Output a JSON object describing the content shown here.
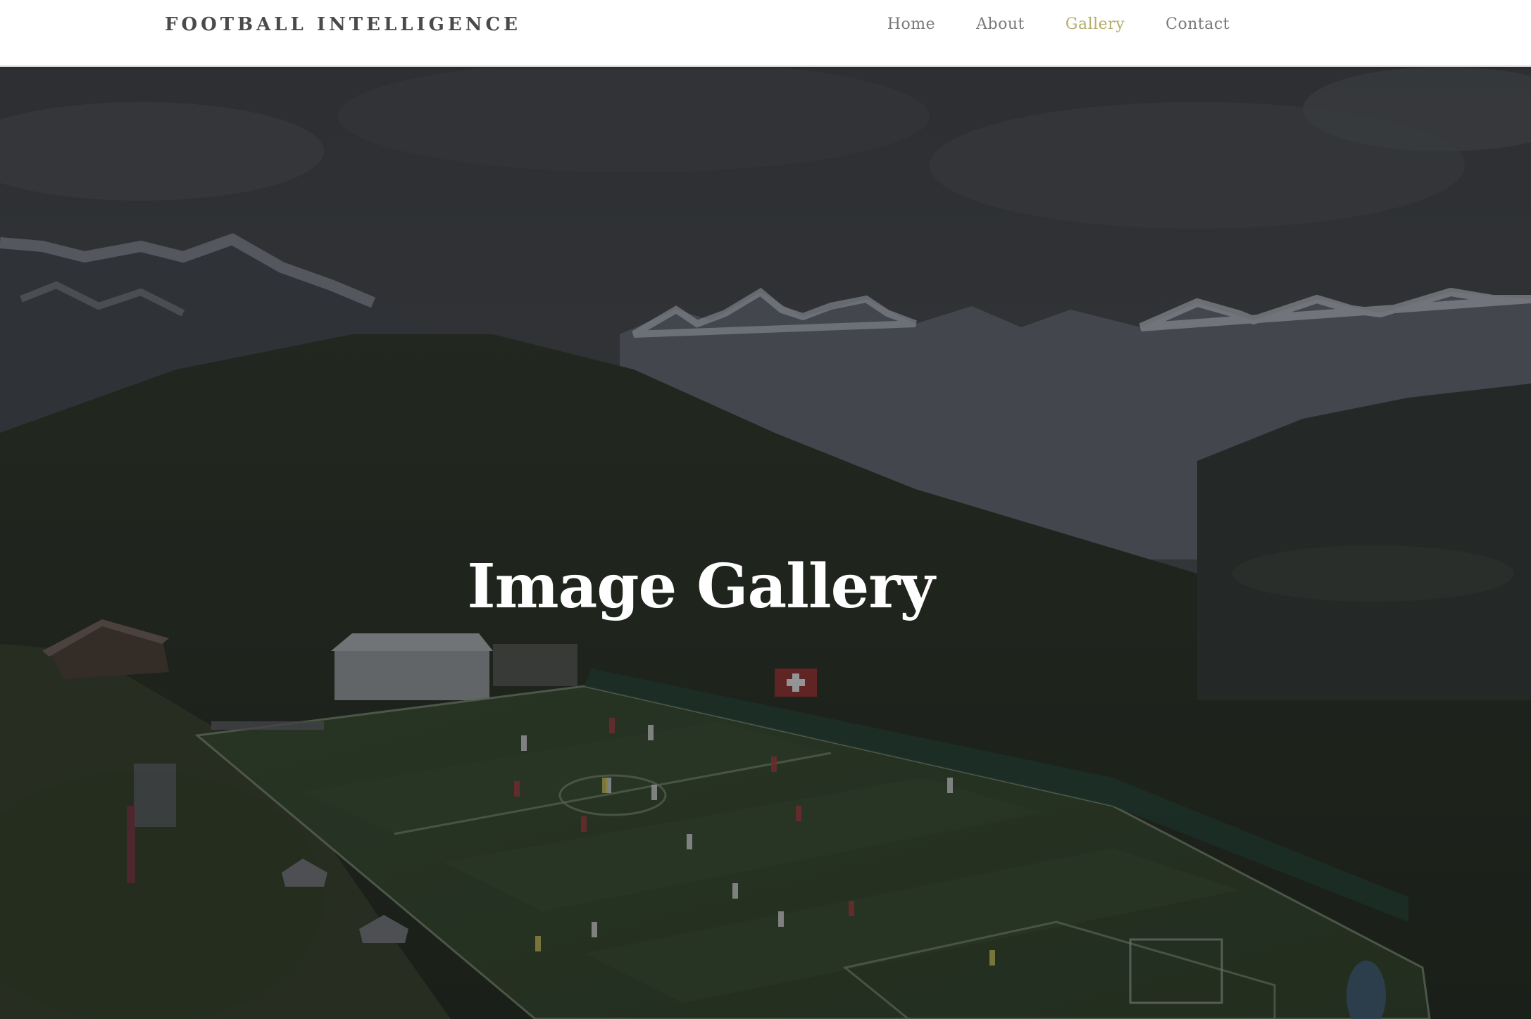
{
  "navbar": {
    "brand": "FOOTBALL INTELLIGENCE",
    "items": [
      {
        "label": "Home",
        "active": false
      },
      {
        "label": "About",
        "active": false
      },
      {
        "label": "Gallery",
        "active": true
      },
      {
        "label": "Contact",
        "active": false
      }
    ]
  },
  "hero": {
    "title": "Image Gallery",
    "background": "mountain-football-pitch-photo"
  },
  "colors": {
    "accent": "#b5ad6a",
    "nav_text": "#7a7a7a",
    "brand_text": "#4a4a4a",
    "overlay": "rgba(20,22,26,0.55)"
  }
}
